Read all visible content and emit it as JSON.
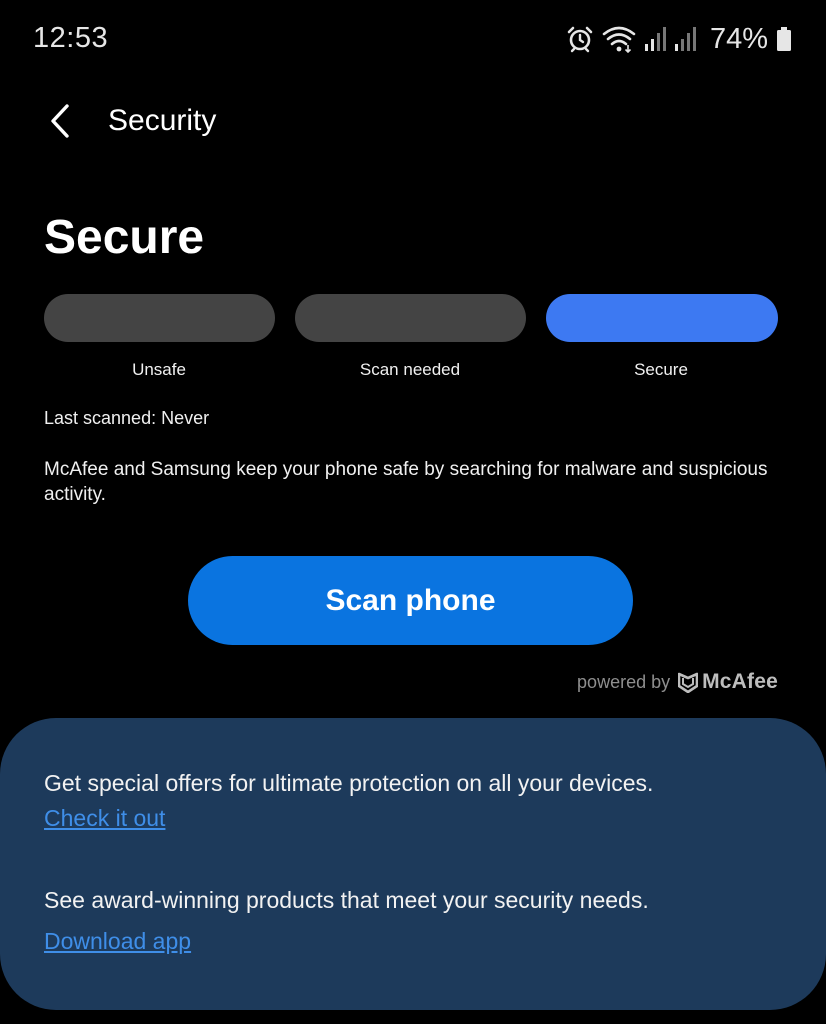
{
  "status_bar": {
    "time": "12:53",
    "battery": "74%",
    "icons": [
      "alarm-icon",
      "wifi-icon",
      "signal-icon",
      "signal-icon",
      "battery-icon"
    ]
  },
  "header": {
    "back_icon": "chevron-left-icon",
    "title": "Security"
  },
  "security_status": {
    "heading": "Secure",
    "levels": [
      {
        "label": "Unsafe",
        "active": false
      },
      {
        "label": "Scan needed",
        "active": false
      },
      {
        "label": "Secure",
        "active": true
      }
    ],
    "active_color": "#3d79f2",
    "inactive_color": "#444444"
  },
  "scan_info": {
    "last_scanned": "Last scanned: Never",
    "description": "McAfee and Samsung keep your phone safe by searching for malware and suspicious activity."
  },
  "scan_button": {
    "label": "Scan phone",
    "color": "#0a74e0"
  },
  "powered_by": {
    "text": "powered by",
    "brand": "McAfee"
  },
  "offers": {
    "card_color": "#1d3a5b",
    "offer1_text": "Get special offers for ultimate protection on all your devices.",
    "offer1_link": "Check it out",
    "offer2_text": "See award-winning products that meet your security needs.",
    "offer2_link": "Download app",
    "link_color": "#3f8ee8"
  }
}
